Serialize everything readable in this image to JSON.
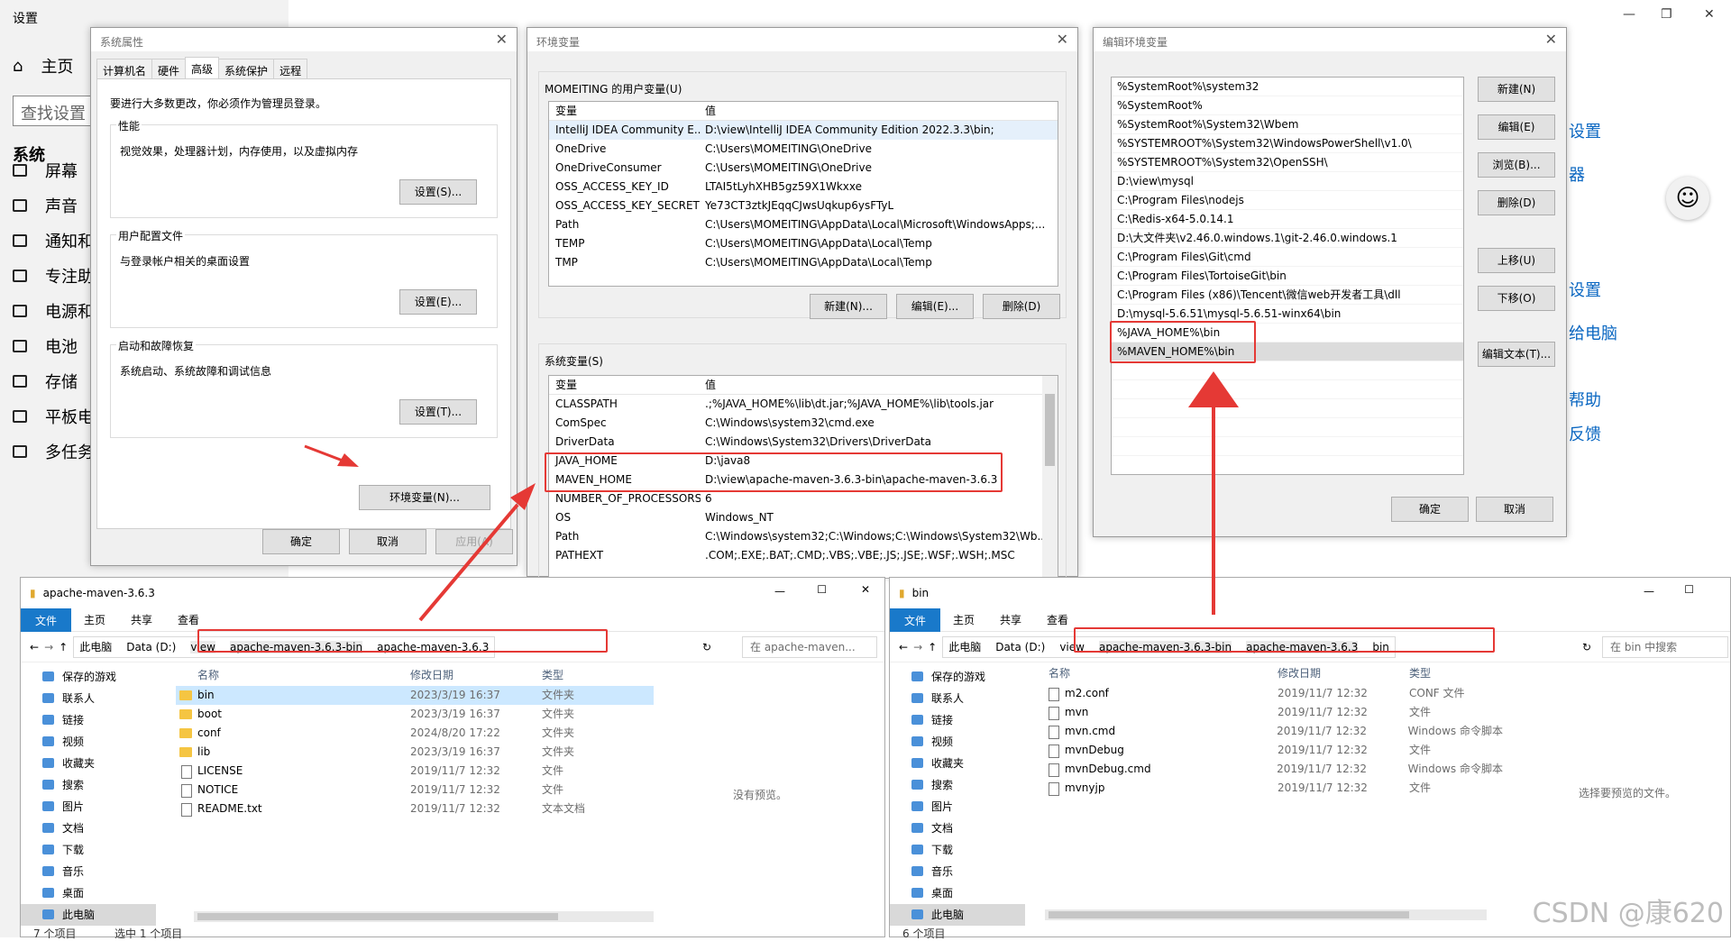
{
  "settings": {
    "title": "设置",
    "home": "主页",
    "search_placeholder": "查找设置",
    "section": "系统",
    "nav": [
      "屏幕",
      "声音",
      "通知和",
      "专注助",
      "电源和",
      "电池",
      "存储",
      "平板电",
      "多任务"
    ],
    "right_links": [
      "设置",
      "器",
      "设置",
      "给电脑",
      "帮助",
      "反馈"
    ]
  },
  "sysprop": {
    "title": "系统属性",
    "tabs": [
      "计算机名",
      "硬件",
      "高级",
      "系统保护",
      "远程"
    ],
    "active_tab": "高级",
    "admin_note": "要进行大多数更改，你必须作为管理员登录。",
    "groups": [
      {
        "title": "性能",
        "desc": "视觉效果，处理器计划，内存使用，以及虚拟内存",
        "button": "设置(S)..."
      },
      {
        "title": "用户配置文件",
        "desc": "与登录帐户相关的桌面设置",
        "button": "设置(E)..."
      },
      {
        "title": "启动和故障恢复",
        "desc": "系统启动、系统故障和调试信息",
        "button": "设置(T)..."
      }
    ],
    "env_button": "环境变量(N)...",
    "ok": "确定",
    "cancel": "取消",
    "apply": "应用(A)"
  },
  "envvars": {
    "title": "环境变量",
    "user_label": "MOMEITING 的用户变量(U)",
    "col_var": "变量",
    "col_val": "值",
    "user_vars": [
      [
        "IntelliJ IDEA Community E...",
        "D:\\view\\IntelliJ IDEA Community Edition 2022.3.3\\bin;"
      ],
      [
        "OneDrive",
        "C:\\Users\\MOMEITING\\OneDrive"
      ],
      [
        "OneDriveConsumer",
        "C:\\Users\\MOMEITING\\OneDrive"
      ],
      [
        "OSS_ACCESS_KEY_ID",
        "LTAI5tLyhXHB5gz59X1Wkxxe"
      ],
      [
        "OSS_ACCESS_KEY_SECRET",
        "Ye73CT3ztkJEqqCJwsUqkup6ysFTyL"
      ],
      [
        "Path",
        "C:\\Users\\MOMEITING\\AppData\\Local\\Microsoft\\WindowsApps;..."
      ],
      [
        "TEMP",
        "C:\\Users\\MOMEITING\\AppData\\Local\\Temp"
      ],
      [
        "TMP",
        "C:\\Users\\MOMEITING\\AppData\\Local\\Temp"
      ]
    ],
    "user_buttons": [
      "新建(N)...",
      "编辑(E)...",
      "删除(D)"
    ],
    "sys_label": "系统变量(S)",
    "sys_vars": [
      [
        "CLASSPATH",
        ".;%JAVA_HOME%\\lib\\dt.jar;%JAVA_HOME%\\lib\\tools.jar"
      ],
      [
        "ComSpec",
        "C:\\Windows\\system32\\cmd.exe"
      ],
      [
        "DriverData",
        "C:\\Windows\\System32\\Drivers\\DriverData"
      ],
      [
        "JAVA_HOME",
        "D:\\java8"
      ],
      [
        "MAVEN_HOME",
        "D:\\view\\apache-maven-3.6.3-bin\\apache-maven-3.6.3"
      ],
      [
        "NUMBER_OF_PROCESSORS",
        "6"
      ],
      [
        "OS",
        "Windows_NT"
      ],
      [
        "Path",
        "C:\\Windows\\system32;C:\\Windows;C:\\Windows\\System32\\Wb..."
      ],
      [
        "PATHEXT",
        ".COM;.EXE;.BAT;.CMD;.VBS;.VBE;.JS;.JSE;.WSF;.WSH;.MSC"
      ]
    ]
  },
  "editenv": {
    "title": "编辑环境变量",
    "entries": [
      "%SystemRoot%\\system32",
      "%SystemRoot%",
      "%SystemRoot%\\System32\\Wbem",
      "%SYSTEMROOT%\\System32\\WindowsPowerShell\\v1.0\\",
      "%SYSTEMROOT%\\System32\\OpenSSH\\",
      "D:\\view\\mysql",
      "C:\\Program Files\\nodejs",
      "C:\\Redis-x64-5.0.14.1",
      "D:\\大文件夹\\v2.46.0.windows.1\\git-2.46.0.windows.1",
      "C:\\Program Files\\Git\\cmd",
      "C:\\Program Files\\TortoiseGit\\bin",
      "C:\\Program Files (x86)\\Tencent\\微信web开发者工具\\dll",
      "D:\\mysql-5.6.51\\mysql-5.6.51-winx64\\bin",
      "%JAVA_HOME%\\bin",
      "%MAVEN_HOME%\\bin"
    ],
    "buttons": [
      "新建(N)",
      "编辑(E)",
      "浏览(B)...",
      "删除(D)",
      "上移(U)",
      "下移(O)",
      "编辑文本(T)..."
    ],
    "ok": "确定",
    "cancel": "取消"
  },
  "explorer_left": {
    "title": "apache-maven-3.6.3",
    "ribbon": [
      "文件",
      "主页",
      "共享",
      "查看"
    ],
    "path": [
      "此电脑",
      "Data (D:)",
      "view",
      "apache-maven-3.6.3-bin",
      "apache-maven-3.6.3"
    ],
    "search": "在 apache-maven...",
    "nav": [
      "保存的游戏",
      "联系人",
      "链接",
      "视频",
      "收藏夹",
      "搜索",
      "图片",
      "文档",
      "下载",
      "音乐",
      "桌面",
      "此电脑"
    ],
    "cols": [
      "名称",
      "修改日期",
      "类型"
    ],
    "files": [
      [
        "bin",
        "2023/3/19 16:37",
        "文件夹",
        "folder"
      ],
      [
        "boot",
        "2023/3/19 16:37",
        "文件夹",
        "folder"
      ],
      [
        "conf",
        "2024/8/20 17:22",
        "文件夹",
        "folder"
      ],
      [
        "lib",
        "2023/3/19 16:37",
        "文件夹",
        "folder"
      ],
      [
        "LICENSE",
        "2019/11/7 12:32",
        "文件",
        "doc"
      ],
      [
        "NOTICE",
        "2019/11/7 12:32",
        "文件",
        "doc"
      ],
      [
        "README.txt",
        "2019/11/7 12:32",
        "文本文档",
        "doc"
      ]
    ],
    "preview": "没有预览。",
    "status": "7 个项目",
    "selected": "选中 1 个项目"
  },
  "explorer_right": {
    "title": "bin",
    "ribbon": [
      "文件",
      "主页",
      "共享",
      "查看"
    ],
    "path": [
      "此电脑",
      "Data (D:)",
      "view",
      "apache-maven-3.6.3-bin",
      "apache-maven-3.6.3",
      "bin"
    ],
    "search": "在 bin 中搜索",
    "nav": [
      "保存的游戏",
      "联系人",
      "链接",
      "视频",
      "收藏夹",
      "搜索",
      "图片",
      "文档",
      "下载",
      "音乐",
      "桌面",
      "此电脑"
    ],
    "cols": [
      "名称",
      "修改日期",
      "类型"
    ],
    "files": [
      [
        "m2.conf",
        "2019/11/7 12:32",
        "CONF 文件",
        "doc"
      ],
      [
        "mvn",
        "2019/11/7 12:32",
        "文件",
        "doc"
      ],
      [
        "mvn.cmd",
        "2019/11/7 12:32",
        "Windows 命令脚本",
        "doc"
      ],
      [
        "mvnDebug",
        "2019/11/7 12:32",
        "文件",
        "doc"
      ],
      [
        "mvnDebug.cmd",
        "2019/11/7 12:32",
        "Windows 命令脚本",
        "doc"
      ],
      [
        "mvnyjp",
        "2019/11/7 12:32",
        "文件",
        "doc"
      ]
    ],
    "preview": "选择要预览的文件。",
    "status": "6 个项目"
  },
  "watermark": "CSDN @康620",
  "colors": {
    "accent": "#1979ca",
    "highlight": "#e53935"
  }
}
